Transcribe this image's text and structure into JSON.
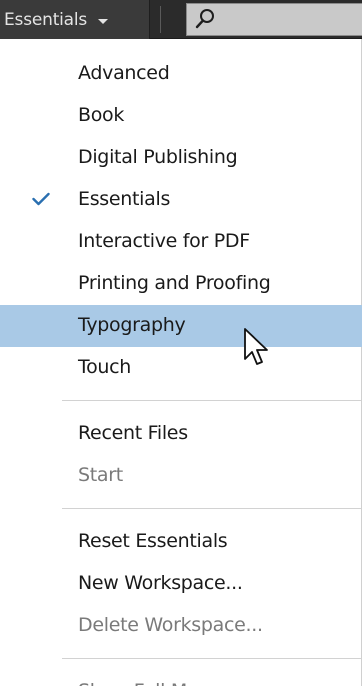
{
  "topbar": {
    "workspace_label": "Essentials",
    "search": {
      "value": "",
      "icon": "search-icon"
    }
  },
  "menu": {
    "groups": [
      {
        "items": [
          {
            "label": "Advanced",
            "checked": false,
            "highlighted": false,
            "disabled": false
          },
          {
            "label": "Book",
            "checked": false,
            "highlighted": false,
            "disabled": false
          },
          {
            "label": "Digital Publishing",
            "checked": false,
            "highlighted": false,
            "disabled": false
          },
          {
            "label": "Essentials",
            "checked": true,
            "highlighted": false,
            "disabled": false
          },
          {
            "label": "Interactive for PDF",
            "checked": false,
            "highlighted": false,
            "disabled": false
          },
          {
            "label": "Printing and Proofing",
            "checked": false,
            "highlighted": false,
            "disabled": false
          },
          {
            "label": "Typography",
            "checked": false,
            "highlighted": true,
            "disabled": false
          },
          {
            "label": "Touch",
            "checked": false,
            "highlighted": false,
            "disabled": false
          }
        ]
      },
      {
        "items": [
          {
            "label": "Recent Files",
            "checked": false,
            "highlighted": false,
            "disabled": false
          },
          {
            "label": "Start",
            "checked": false,
            "highlighted": false,
            "disabled": true
          }
        ]
      },
      {
        "items": [
          {
            "label": "Reset Essentials",
            "checked": false,
            "highlighted": false,
            "disabled": false
          },
          {
            "label": "New Workspace...",
            "checked": false,
            "highlighted": false,
            "disabled": false
          },
          {
            "label": "Delete Workspace...",
            "checked": false,
            "highlighted": false,
            "disabled": true
          }
        ]
      },
      {
        "items": [
          {
            "label": "Show Full Menus",
            "checked": false,
            "highlighted": false,
            "disabled": true
          }
        ]
      }
    ]
  },
  "colors": {
    "highlight": "#a9c9e6",
    "check": "#2a6fb0",
    "topbar": "#2b2b2b",
    "disabled_text": "#7a7a7a"
  }
}
